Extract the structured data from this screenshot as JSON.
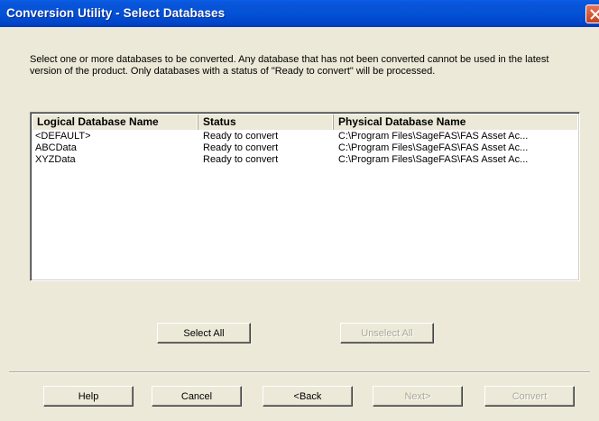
{
  "window": {
    "title": "Conversion Utility - Select Databases"
  },
  "description": "Select one or more databases to be converted. Any database that has not been converted cannot be used in the latest version of the product. Only databases with a status of \"Ready to convert\" will be processed.",
  "table": {
    "columns": [
      "Logical Database Name",
      "Status",
      "Physical Database Name"
    ],
    "rows": [
      [
        "<DEFAULT>",
        "Ready to convert",
        "C:\\Program Files\\SageFAS\\FAS Asset Ac..."
      ],
      [
        "ABCData",
        "Ready to convert",
        "C:\\Program Files\\SageFAS\\FAS Asset Ac..."
      ],
      [
        "XYZData",
        "Ready to convert",
        "C:\\Program Files\\SageFAS\\FAS Asset Ac..."
      ]
    ]
  },
  "selection_buttons": {
    "select_all": "Select All",
    "unselect_all": "Unselect All"
  },
  "nav_buttons": {
    "help": "Help",
    "cancel": "Cancel",
    "back": "<Back",
    "next": "Next>",
    "convert": "Convert"
  },
  "colors": {
    "titlebar": "#0352d6",
    "face": "#ece9d8",
    "disabled_text": "#aca899"
  },
  "icons": {
    "close": "close-icon"
  }
}
